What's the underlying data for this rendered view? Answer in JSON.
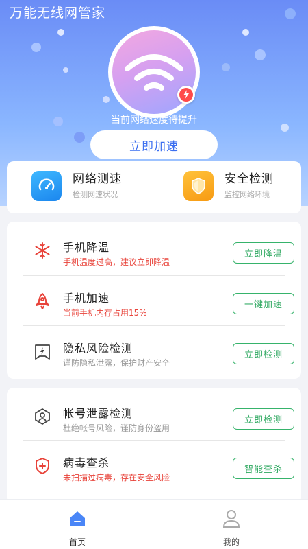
{
  "app": {
    "title": "万能无线网管家"
  },
  "hero": {
    "status_text": "当前网络速度待提升",
    "speed_button": "立即加速"
  },
  "quick": [
    {
      "title": "网络测速",
      "subtitle": "检测网速状况",
      "icon": "speedometer-icon",
      "color": "#2f9cf3"
    },
    {
      "title": "安全检测",
      "subtitle": "监控网络环境",
      "icon": "shield-icon",
      "color": "#f7a41c"
    }
  ],
  "list_1": [
    {
      "title": "手机降温",
      "subtitle": "手机温度过高，建议立即降温",
      "button": "立即降温",
      "icon": "snowflake-icon"
    },
    {
      "title": "手机加速",
      "subtitle": "当前手机内存占用15%",
      "button": "一键加速",
      "icon": "rocket-icon"
    },
    {
      "title": "隐私风险检测",
      "subtitle": "谨防隐私泄露，保护财产安全",
      "button": "立即检测",
      "icon": "privacy-icon"
    }
  ],
  "list_2": [
    {
      "title": "帐号泄露检测",
      "subtitle": "杜绝帐号风险，谨防身份盗用",
      "button": "立即检测",
      "icon": "account-icon"
    },
    {
      "title": "病毒查杀",
      "subtitle": "未扫描过病毒，存在安全风险",
      "button": "智能查杀",
      "icon": "virus-shield-icon"
    }
  ],
  "nav": [
    {
      "label": "首页",
      "active": true
    },
    {
      "label": "我的",
      "active": false
    }
  ],
  "colors": {
    "accent_blue": "#3c6ff0",
    "active_nav": "#4a86f7",
    "warn_red": "#e8433a",
    "green": "#36b36b"
  }
}
